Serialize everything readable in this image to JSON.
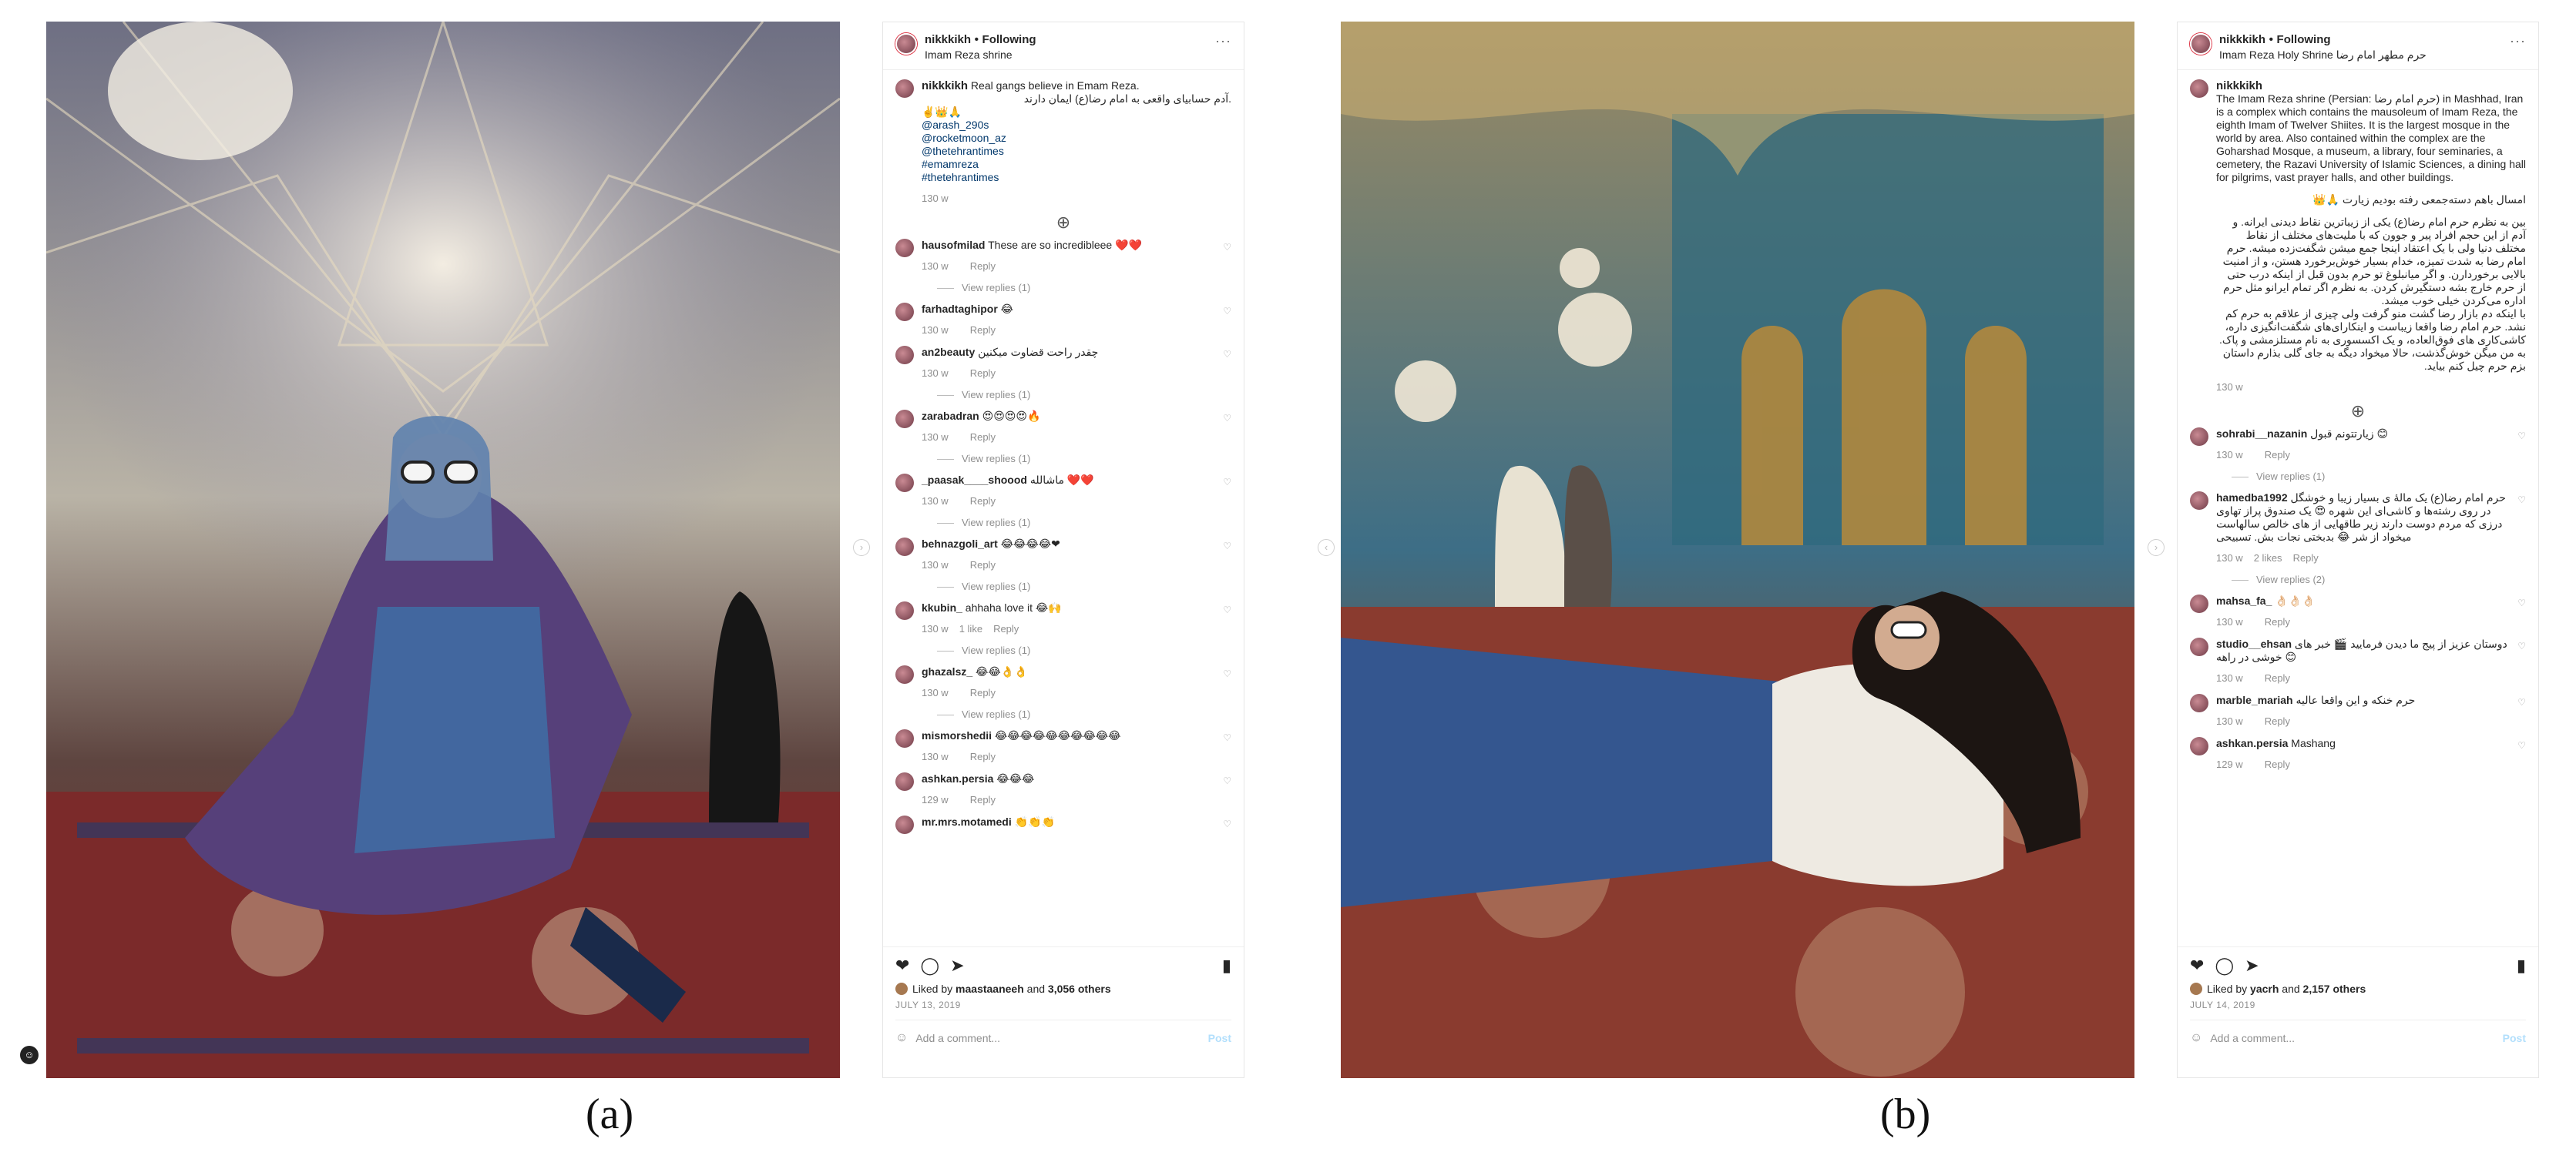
{
  "panels": {
    "a": {
      "label": "(a)",
      "header": {
        "username": "nikkkikh",
        "follow": "Following",
        "location": "Imam Reza shrine",
        "more": "···"
      },
      "caption": {
        "username": "nikkkikh",
        "text": "Real gangs believe in Emam Reza.",
        "text_fa": ".آدم حسابیای واقعی به امام رضا(ع) ایمان دارند",
        "emoji": "✌️👑🙏",
        "mentions": [
          "@arash_290s",
          "@rocketmoon_az",
          "@thetehrantimes",
          "#emamreza",
          "#thetehrantimes"
        ],
        "time": "130 w"
      },
      "load_more_icon": "plus-circle-icon",
      "comments": [
        {
          "user": "hausofmilad",
          "text": "These are so incredibleee ❤️❤️",
          "time": "130 w",
          "likes": "",
          "reply": "Reply",
          "view_replies": "View replies (1)"
        },
        {
          "user": "farhadtaghipor",
          "text": "😂",
          "time": "130 w",
          "likes": "",
          "reply": "Reply",
          "view_replies": ""
        },
        {
          "user": "an2beauty",
          "text": "چقدر راحت قضاوت میکنین",
          "time": "130 w",
          "likes": "",
          "reply": "Reply",
          "view_replies": "View replies (1)"
        },
        {
          "user": "zarabadran",
          "text": "😍😍😍😍🔥",
          "time": "130 w",
          "likes": "",
          "reply": "Reply",
          "view_replies": "View replies (1)"
        },
        {
          "user": "_paasak____shoood",
          "text": "ماشالله ❤️❤️",
          "time": "130 w",
          "likes": "",
          "reply": "Reply",
          "view_replies": "View replies (1)"
        },
        {
          "user": "behnazgoli_art",
          "text": "😂😂😂😂❤",
          "time": "130 w",
          "likes": "",
          "reply": "Reply",
          "view_replies": "View replies (1)"
        },
        {
          "user": "kkubin_",
          "text": "ahhaha love it 😂🙌",
          "time": "130 w",
          "likes": "1 like",
          "reply": "Reply",
          "view_replies": "View replies (1)"
        },
        {
          "user": "ghazalsz_",
          "text": "😂😂👌👌",
          "time": "130 w",
          "likes": "",
          "reply": "Reply",
          "view_replies": "View replies (1)"
        },
        {
          "user": "mismorshedii",
          "text": "😂😂😂😂😂😂😂😂😂😂",
          "time": "130 w",
          "likes": "",
          "reply": "Reply",
          "view_replies": ""
        },
        {
          "user": "ashkan.persia",
          "text": "😂😂😂",
          "time": "129 w",
          "likes": "",
          "reply": "Reply",
          "view_replies": ""
        },
        {
          "user": "mr.mrs.motamedi",
          "text": "👏👏👏",
          "time": "",
          "likes": "",
          "reply": "",
          "view_replies": ""
        }
      ],
      "footer": {
        "liked_by_prefix": "Liked by",
        "liked_by_user": "maastaaneeh",
        "liked_by_and": "and",
        "liked_by_count": "3,056 others",
        "date": "JULY 13, 2019",
        "add_comment_placeholder": "Add a comment...",
        "post_label": "Post"
      }
    },
    "b": {
      "label": "(b)",
      "header": {
        "username": "nikkkikh",
        "follow": "Following",
        "location": "Imam Reza Holy Shrine",
        "location_fa": "حرم مطهر امام رضا",
        "more": "···"
      },
      "caption": {
        "username": "nikkkikh",
        "text": "The Imam Reza shrine (Persian: حرم امام رضا) in Mashhad, Iran is a complex which contains the mausoleum of Imam Reza, the eighth Imam of Twelver Shiites. It is the largest mosque in the world by area. Also contained within the complex are the Goharshad Mosque, a museum, a library, four seminaries, a cemetery, the Razavi University of Islamic Sciences, a dining hall for pilgrims, vast prayer halls, and other buildings.",
        "text_fa_1": "امسال باهم دسته‌جمعی رفته بودیم زیارت 🙏👑",
        "text_fa_2": "بین به نظرم حرم امام رضا(ع) یکی از زیباترین نقاط دیدنی ایرانه. و آدم از این حجم افراد پیر و جوون که با ملیت‌های مختلف از نقاط مختلف دنیا ولی با یک اعتقاد اینجا جمع میشن شگفت‌زده میشه. حرم امام رضا به شدت تمیزه، خدام بسیار خوش‌برخورد هستن، و از امنیت بالایی برخوردارن. و اگر میانبلوغ تو حرم بدون قبل از اینکه درب حتی از حرم خارج بشه دستگیرش کردن. به نظرم اگر تمام ایرانو مثل حرم اداره می‌کردن خیلی خوب میشد.",
        "text_fa_3": "با اینکه دم بازار رضا گشت منو گرفت ولی چیزی از علاقم به حرم کم نشد. حرم امام رضا واقعا زیباست و اینکارای‌های شگفت‌انگیزی داره، کاشی‌کاری های فوق‌العاده، و یک اکسسوری به نام مستلزمشی و پاک. به من میگن خوش‌گذشت، حالا میخواد دیگه به جای گلی بذارم داستان بزم حرم چیل کنم بیاید.",
        "time": "130 w"
      },
      "load_more_icon": "plus-circle-icon",
      "comments": [
        {
          "user": "sohrabi__nazanin",
          "text": "زیارتتونم قبول 😊",
          "time": "130 w",
          "likes": "",
          "reply": "Reply",
          "view_replies": "View replies (1)"
        },
        {
          "user": "hamedba1992",
          "text": "حرم امام رضا(ع) یک مالۀ ی بسیار زیبا و خوشگل در روی رشته‌ها و کاشی‌ای این شهره 😍 یک صندوق پراز تهاوی درزی که مردم دوست دارند زیر طاقهایی از های خالص سالهاست میخواد از شر 😂 بدبختی نجات بش. تسبیحی",
          "time": "130 w",
          "likes": "2 likes",
          "reply": "Reply",
          "view_replies": "View replies (2)"
        },
        {
          "user": "mahsa_fa_",
          "text": "👌🏻👌🏻👌🏻",
          "time": "130 w",
          "likes": "",
          "reply": "Reply",
          "view_replies": ""
        },
        {
          "user": "studio__ehsan",
          "text": "دوستان عزیز از پیج ما دیدن فرمایید 🎬 خبر های خوشی در راهه 😊",
          "time": "130 w",
          "likes": "",
          "reply": "Reply",
          "view_replies": ""
        },
        {
          "user": "marble_mariah",
          "text": "حرم خنکه و این واقعا عالیه",
          "time": "130 w",
          "likes": "",
          "reply": "Reply",
          "view_replies": ""
        },
        {
          "user": "ashkan.persia",
          "text": "Mashang",
          "time": "129 w",
          "likes": "",
          "reply": "Reply",
          "view_replies": ""
        }
      ],
      "footer": {
        "liked_by_prefix": "Liked by",
        "liked_by_user": "yacrh",
        "liked_by_and": "and",
        "liked_by_count": "2,157 others",
        "date": "JULY 14, 2019",
        "add_comment_placeholder": "Add a comment...",
        "post_label": "Post"
      }
    }
  },
  "colors": {
    "like_red": "#ed4956",
    "link_blue": "#00376b",
    "muted": "#8e8e8e",
    "post_disabled": "#b2dffc"
  },
  "icons": [
    "heart-icon",
    "comment-icon",
    "share-icon",
    "bookmark-icon",
    "smiley-icon",
    "more-dots-icon",
    "plus-circle-icon",
    "chevron-left-icon",
    "chevron-right-icon"
  ]
}
